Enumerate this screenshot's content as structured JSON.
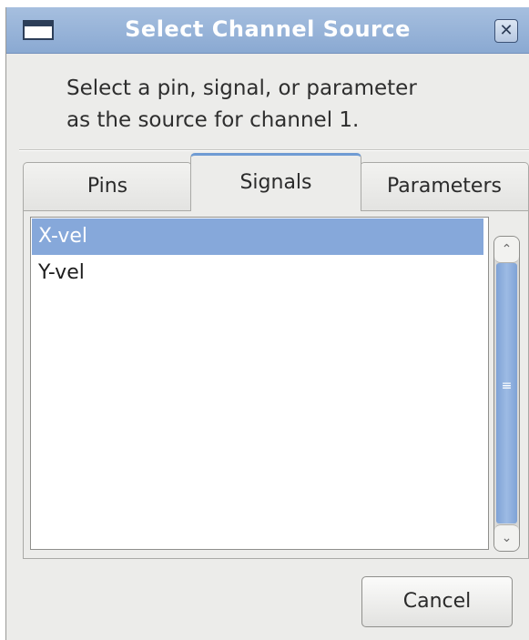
{
  "dialog": {
    "title": "Select Channel Source",
    "close_glyph": "✕",
    "message_line1": "Select a pin, signal, or parameter",
    "message_line2": "as the source for channel 1."
  },
  "tabs": [
    {
      "label": "Pins",
      "active": false
    },
    {
      "label": "Signals",
      "active": true
    },
    {
      "label": "Parameters",
      "active": false
    }
  ],
  "list": {
    "items": [
      {
        "label": "X-vel",
        "selected": true
      },
      {
        "label": "Y-vel",
        "selected": false
      }
    ]
  },
  "scrollbar": {
    "up_glyph": "⌃",
    "down_glyph": "⌄",
    "grip_glyph": "≡"
  },
  "buttons": {
    "cancel_label": "Cancel"
  },
  "icons": {
    "window": "window-icon",
    "close": "close-icon"
  },
  "colors": {
    "titlebar": "#8aa9d2",
    "selection": "#86a8da",
    "active_tab_accent": "#6f9bd3"
  }
}
